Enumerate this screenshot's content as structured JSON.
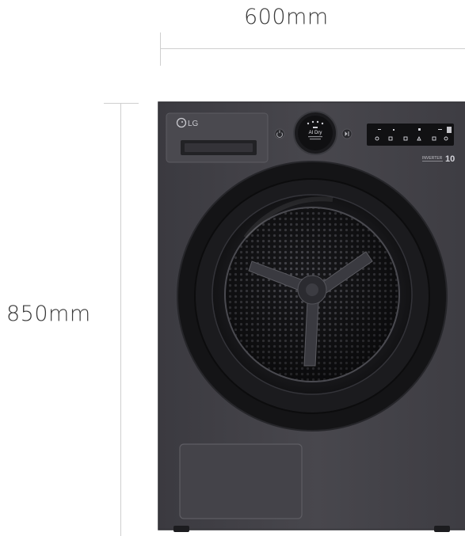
{
  "dimensions": {
    "width": "600mm",
    "height": "850mm"
  },
  "appliance": {
    "brand": "LG",
    "display_text": "AI Dry",
    "badge": "INVERTER",
    "badge_number": "10"
  },
  "colors": {
    "body": "#45444a",
    "door_ring": "#141416",
    "line": "#cfcfcf",
    "label": "#3a3a3a"
  }
}
